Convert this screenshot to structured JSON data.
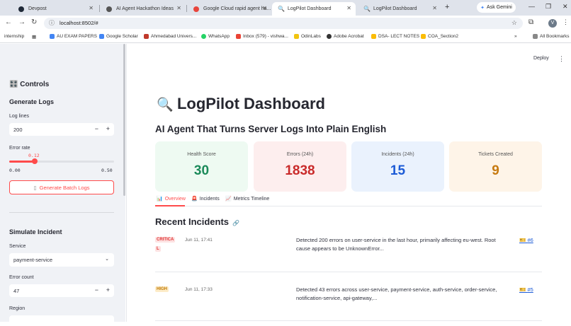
{
  "browser": {
    "tabs": [
      {
        "label": "Devpost",
        "color": "#1f2937"
      },
      {
        "label": "AI Agent Hackathon Ideas",
        "color": "#555555"
      },
      {
        "label": "Google Cloud rapid agent ha...",
        "color": "#e8453c"
      },
      {
        "label": "LogPilot Dashboard",
        "color": "#3b82f6"
      },
      {
        "label": "LogPilot Dashboard",
        "color": "#3b82f6"
      }
    ],
    "gemini_label": "Ask Gemini",
    "url": "localhost:8502/#",
    "profile_initial": "V",
    "bookmarks": [
      {
        "label": "internship",
        "color": "#8a8a8a"
      },
      {
        "label": "AU EXAM PAPERS",
        "color": "#4285f4"
      },
      {
        "label": "Google Scholar",
        "color": "#4285f4"
      },
      {
        "label": "Ahmedabad Univers...",
        "color": "#c0392b"
      },
      {
        "label": "WhatsApp",
        "color": "#25d366"
      },
      {
        "label": "Inbox (579) - vishwa...",
        "color": "#ea4335"
      },
      {
        "label": "OdinLabs",
        "color": "#f1c40f"
      },
      {
        "label": "Adobe Acrobat",
        "color": "#333333"
      },
      {
        "label": "DSA- LECT NOTES",
        "color": "#fbbc05"
      },
      {
        "label": "COA_Section2",
        "color": "#fbbc05"
      }
    ],
    "all_bookmarks": "All Bookmarks"
  },
  "sidebar": {
    "title": "Controls",
    "generate_heading": "Generate Logs",
    "log_lines_label": "Log lines",
    "log_lines_value": "200",
    "error_rate_label": "Error rate",
    "error_rate_value": "0.12",
    "error_rate_fraction": 0.24,
    "error_rate_min": "0.00",
    "error_rate_max": "0.50",
    "generate_button": "Generate Batch Logs",
    "simulate_heading": "Simulate Incident",
    "service_label": "Service",
    "service_value": "payment-service",
    "error_count_label": "Error count",
    "error_count_value": "47",
    "region_label": "Region"
  },
  "topbar": {
    "deploy": "Deploy"
  },
  "main": {
    "title": "LogPilot Dashboard",
    "subtitle": "AI Agent That Turns Server Logs Into Plain English",
    "cards": [
      {
        "label": "Health Score",
        "value": "30",
        "bg": "#eefaf2",
        "color": "#1b8a5a"
      },
      {
        "label": "Errors (24h)",
        "value": "1838",
        "bg": "#fdeeee",
        "color": "#c92a2a"
      },
      {
        "label": "Incidents (24h)",
        "value": "15",
        "bg": "#eaf2fd",
        "color": "#1c5bd6"
      },
      {
        "label": "Tickets Created",
        "value": "9",
        "bg": "#fef4e8",
        "color": "#c77a10"
      }
    ],
    "tabs": [
      {
        "label": "Overview"
      },
      {
        "label": "Incidents"
      },
      {
        "label": "Metrics Timeline"
      }
    ],
    "section_title": "Recent Incidents",
    "incidents": [
      {
        "severity_line1": "CRITICA",
        "severity_line2": "L",
        "time": "Jun 11, 17:41",
        "desc_line1": "Detected 200 errors on user-service in the last hour, primarily affecting eu-west. Root",
        "desc_line2": "cause appears to be UnknownError...",
        "ticket": "#6"
      },
      {
        "severity_line1": "HIGH",
        "time": "Jun 11, 17:33",
        "desc_line1": "Detected 43 errors across user-service, payment-service, auth-service, order-service,",
        "desc_line2": "notification-service, api-gateway,...",
        "ticket": "#5"
      }
    ]
  }
}
